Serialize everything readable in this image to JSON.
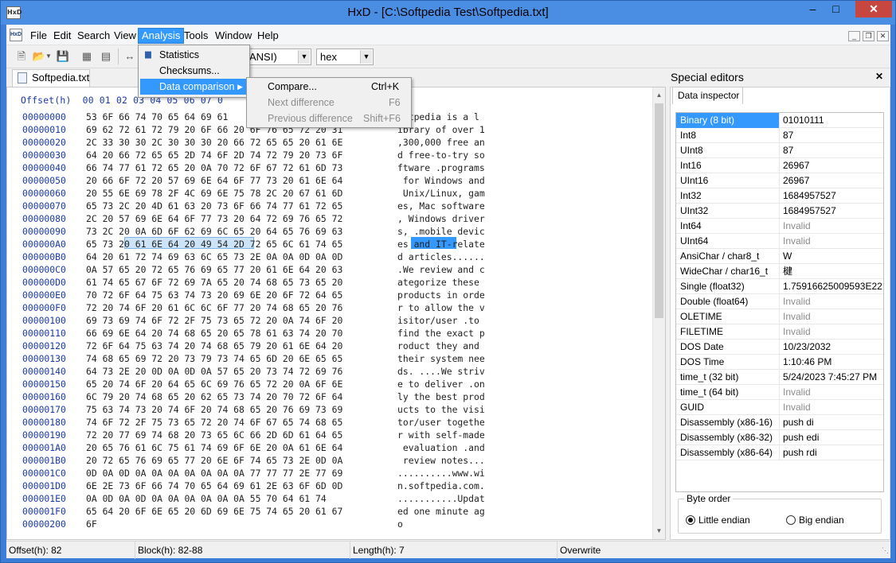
{
  "window": {
    "title": "HxD - [C:\\Softpedia Test\\Softpedia.txt]"
  },
  "menubar": {
    "items": [
      "File",
      "Edit",
      "Search",
      "View",
      "Analysis",
      "Tools",
      "Window",
      "Help"
    ],
    "active": "Analysis"
  },
  "toolbar": {
    "encoding_value": "ANSI)",
    "display_value": "hex"
  },
  "doc_tab": {
    "label": "Softpedia.txt"
  },
  "hex": {
    "header": "Offset(h)  00 01 02 03 04 05 06 07 0",
    "rows": [
      {
        "off": "00000000",
        "hex": "53 6F 66 74 70 65 64 69 61",
        "txt": "oftpedia is a l"
      },
      {
        "off": "00000010",
        "hex": "69 62 72 61 72 79 20 6F 66 20 6F 76 65 72 20 31",
        "txt": "ibrary of over 1"
      },
      {
        "off": "00000020",
        "hex": "2C 33 30 30 2C 30 30 30 20 66 72 65 65 20 61 6E",
        "txt": ",300,000 free an"
      },
      {
        "off": "00000030",
        "hex": "64 20 66 72 65 65 2D 74 6F 2D 74 72 79 20 73 6F",
        "txt": "d free-to-try so"
      },
      {
        "off": "00000040",
        "hex": "66 74 77 61 72 65 20 0A 70 72 6F 67 72 61 6D 73",
        "txt": "ftware .programs"
      },
      {
        "off": "00000050",
        "hex": "20 66 6F 72 20 57 69 6E 64 6F 77 73 20 61 6E 64",
        "txt": " for Windows and"
      },
      {
        "off": "00000060",
        "hex": "20 55 6E 69 78 2F 4C 69 6E 75 78 2C 20 67 61 6D",
        "txt": " Unix/Linux, gam"
      },
      {
        "off": "00000070",
        "hex": "65 73 2C 20 4D 61 63 20 73 6F 66 74 77 61 72 65",
        "txt": "es, Mac software"
      },
      {
        "off": "00000080",
        "hex": "2C 20 57 69 6E 64 6F 77 73 20 64 72 69 76 65 72",
        "txt": ", Windows driver"
      },
      {
        "off": "00000090",
        "hex": "73 2C 20 0A 6D 6F 62 69 6C 65 20 64 65 76 69 63",
        "txt": "s, .mobile devic"
      },
      {
        "off": "000000A0",
        "hex": "65 73 20 61 6E 64 20 49 54 2D 72 65 6C 61 74 65",
        "txt": "es and IT-relate"
      },
      {
        "off": "000000B0",
        "hex": "64 20 61 72 74 69 63 6C 65 73 2E 0A 0A 0D 0A 0D",
        "txt": "d articles......"
      },
      {
        "off": "000000C0",
        "hex": "0A 57 65 20 72 65 76 69 65 77 20 61 6E 64 20 63",
        "txt": ".We review and c"
      },
      {
        "off": "000000D0",
        "hex": "61 74 65 67 6F 72 69 7A 65 20 74 68 65 73 65 20",
        "txt": "ategorize these "
      },
      {
        "off": "000000E0",
        "hex": "70 72 6F 64 75 63 74 73 20 69 6E 20 6F 72 64 65",
        "txt": "products in orde"
      },
      {
        "off": "000000F0",
        "hex": "72 20 74 6F 20 61 6C 6C 6F 77 20 74 68 65 20 76",
        "txt": "r to allow the v"
      },
      {
        "off": "00000100",
        "hex": "69 73 69 74 6F 72 2F 75 73 65 72 20 0A 74 6F 20",
        "txt": "isitor/user .to "
      },
      {
        "off": "00000110",
        "hex": "66 69 6E 64 20 74 68 65 20 65 78 61 63 74 20 70",
        "txt": "find the exact p"
      },
      {
        "off": "00000120",
        "hex": "72 6F 64 75 63 74 20 74 68 65 79 20 61 6E 64 20",
        "txt": "roduct they and "
      },
      {
        "off": "00000130",
        "hex": "74 68 65 69 72 20 73 79 73 74 65 6D 20 6E 65 65",
        "txt": "their system nee"
      },
      {
        "off": "00000140",
        "hex": "64 73 2E 20 0D 0A 0D 0A 57 65 20 73 74 72 69 76",
        "txt": "ds. ....We striv"
      },
      {
        "off": "00000150",
        "hex": "65 20 74 6F 20 64 65 6C 69 76 65 72 20 0A 6F 6E",
        "txt": "e to deliver .on"
      },
      {
        "off": "00000160",
        "hex": "6C 79 20 74 68 65 20 62 65 73 74 20 70 72 6F 64",
        "txt": "ly the best prod"
      },
      {
        "off": "00000170",
        "hex": "75 63 74 73 20 74 6F 20 74 68 65 20 76 69 73 69",
        "txt": "ucts to the visi"
      },
      {
        "off": "00000180",
        "hex": "74 6F 72 2F 75 73 65 72 20 74 6F 67 65 74 68 65",
        "txt": "tor/user togethe"
      },
      {
        "off": "00000190",
        "hex": "72 20 77 69 74 68 20 73 65 6C 66 2D 6D 61 64 65",
        "txt": "r with self-made"
      },
      {
        "off": "000001A0",
        "hex": "20 65 76 61 6C 75 61 74 69 6F 6E 20 0A 61 6E 64",
        "txt": " evaluation .and"
      },
      {
        "off": "000001B0",
        "hex": "20 72 65 76 69 65 77 20 6E 6F 74 65 73 2E 0D 0A",
        "txt": " review notes..."
      },
      {
        "off": "000001C0",
        "hex": "0D 0A 0D 0A 0A 0A 0A 0A 0A 0A 77 77 77 2E 77 69",
        "txt": "..........www.wi"
      },
      {
        "off": "000001D0",
        "hex": "6E 2E 73 6F 66 74 70 65 64 69 61 2E 63 6F 6D 0D",
        "txt": "n.softpedia.com."
      },
      {
        "off": "000001E0",
        "hex": "0A 0D 0A 0D 0A 0A 0A 0A 0A 0A 55 70 64 61 74",
        "txt": "...........Updat"
      },
      {
        "off": "000001F0",
        "hex": "65 64 20 6F 6E 65 20 6D 69 6E 75 74 65 20 61 67",
        "txt": "ed one minute ag"
      },
      {
        "off": "00000200",
        "hex": "6F",
        "txt": "o"
      }
    ]
  },
  "analysis_menu": {
    "items": [
      "Statistics",
      "Checksums...",
      "Data comparison"
    ]
  },
  "data_comparison_menu": {
    "items": [
      {
        "label": "Compare...",
        "shortcut": "Ctrl+K"
      },
      {
        "label": "Next difference",
        "shortcut": "F6"
      },
      {
        "label": "Previous difference",
        "shortcut": "Shift+F6"
      }
    ]
  },
  "special_editors": {
    "title": "Special editors",
    "tab": "Data inspector",
    "rows": [
      {
        "k": "Binary (8 bit)",
        "v": "01010111",
        "invalid": false
      },
      {
        "k": "Int8",
        "v": "87",
        "invalid": false
      },
      {
        "k": "UInt8",
        "v": "87",
        "invalid": false
      },
      {
        "k": "Int16",
        "v": "26967",
        "invalid": false
      },
      {
        "k": "UInt16",
        "v": "26967",
        "invalid": false
      },
      {
        "k": "Int32",
        "v": "1684957527",
        "invalid": false
      },
      {
        "k": "UInt32",
        "v": "1684957527",
        "invalid": false
      },
      {
        "k": "Int64",
        "v": "Invalid",
        "invalid": true
      },
      {
        "k": "UInt64",
        "v": "Invalid",
        "invalid": true
      },
      {
        "k": "AnsiChar / char8_t",
        "v": "W",
        "invalid": false
      },
      {
        "k": "WideChar / char16_t",
        "v": "楗",
        "invalid": false
      },
      {
        "k": "Single (float32)",
        "v": "1.75916625009593E22",
        "invalid": false
      },
      {
        "k": "Double (float64)",
        "v": "Invalid",
        "invalid": true
      },
      {
        "k": "OLETIME",
        "v": "Invalid",
        "invalid": true
      },
      {
        "k": "FILETIME",
        "v": "Invalid",
        "invalid": true
      },
      {
        "k": "DOS Date",
        "v": "10/23/2032",
        "invalid": false
      },
      {
        "k": "DOS Time",
        "v": "1:10:46 PM",
        "invalid": false
      },
      {
        "k": "time_t (32 bit)",
        "v": "5/24/2023 7:45:27 PM",
        "invalid": false
      },
      {
        "k": "time_t (64 bit)",
        "v": "Invalid",
        "invalid": true
      },
      {
        "k": "GUID",
        "v": "Invalid",
        "invalid": true
      },
      {
        "k": "Disassembly (x86-16)",
        "v": "push di",
        "invalid": false
      },
      {
        "k": "Disassembly (x86-32)",
        "v": "push edi",
        "invalid": false
      },
      {
        "k": "Disassembly (x86-64)",
        "v": "push rdi",
        "invalid": false
      }
    ],
    "byte_order": {
      "legend": "Byte order",
      "little": "Little endian",
      "big": "Big endian",
      "selected": "little"
    }
  },
  "status": {
    "offset": "Offset(h): 82",
    "block": "Block(h): 82-88",
    "length": "Length(h): 7",
    "mode": "Overwrite"
  }
}
